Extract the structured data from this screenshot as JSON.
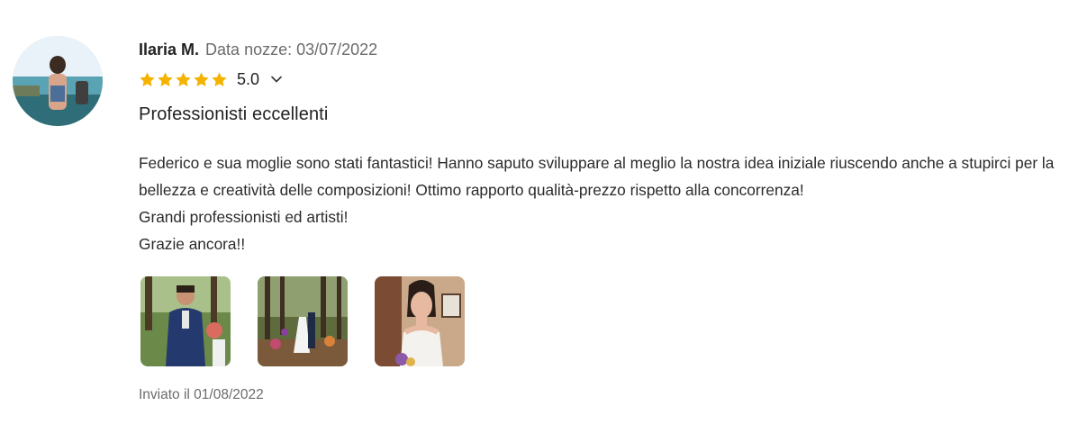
{
  "review": {
    "author": "Ilaria M.",
    "wedding_date": "Data nozze: 03/07/2022",
    "rating": "5.0",
    "stars": 5,
    "title": "Professionisti eccellenti",
    "body": [
      "Federico e sua moglie sono stati fantastici! Hanno saputo sviluppare al meglio la nostra idea iniziale riuscendo anche a stupirci per la bellezza e creatività delle composizioni! Ottimo rapporto qualità-prezzo rispetto alla concorrenza!",
      "Grandi professionisti ed artisti!",
      "Grazie ancora!!"
    ],
    "photos": [
      "photo-groom-ceremony",
      "photo-forest-ceremony",
      "photo-bride-portrait"
    ],
    "sent": "Inviato il 01/08/2022"
  },
  "colors": {
    "star": "#f5b300",
    "muted_text": "#6b6b6b",
    "text": "#222222"
  },
  "icons": {
    "star": "star-icon",
    "chevron": "chevron-down-icon"
  }
}
